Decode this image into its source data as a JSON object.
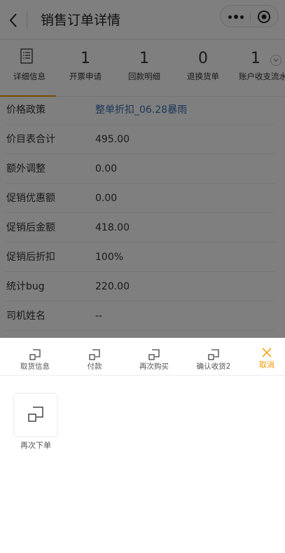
{
  "header": {
    "title": "销售订单详情",
    "back_icon": "chevron-left-icon",
    "more_icon": "more-dots-icon",
    "close_icon": "target-close-icon"
  },
  "tabs": [
    {
      "label": "详细信息",
      "icon": "document-list-icon",
      "active": true
    },
    {
      "label": "开票申请",
      "count": "1"
    },
    {
      "label": "回款明细",
      "count": "1"
    },
    {
      "label": "退换货单",
      "count": "0"
    },
    {
      "label": "账户收支流水",
      "count": "1"
    }
  ],
  "details": [
    {
      "label": "价格政策",
      "value": "整单折扣_06.28暴雨",
      "link": true
    },
    {
      "label": "价目表合计",
      "value": "495.00"
    },
    {
      "label": "额外调整",
      "value": "0.00"
    },
    {
      "label": "促销优惠额",
      "value": "0.00"
    },
    {
      "label": "促销后金额",
      "value": "418.00"
    },
    {
      "label": "促销后折扣",
      "value": "100%"
    },
    {
      "label": "统计bug",
      "value": "220.00"
    },
    {
      "label": "司机姓名",
      "value": "--"
    }
  ],
  "action_sheet": {
    "actions": [
      {
        "label": "取货信息"
      },
      {
        "label": "付款"
      },
      {
        "label": "再次购买"
      },
      {
        "label": "确认收货2"
      }
    ],
    "cancel_label": "取消",
    "tile_label": "再次下单"
  },
  "colors": {
    "accent": "#f39800",
    "link": "#3a6fb0",
    "mask": "rgba(0,0,0,0.5)"
  }
}
